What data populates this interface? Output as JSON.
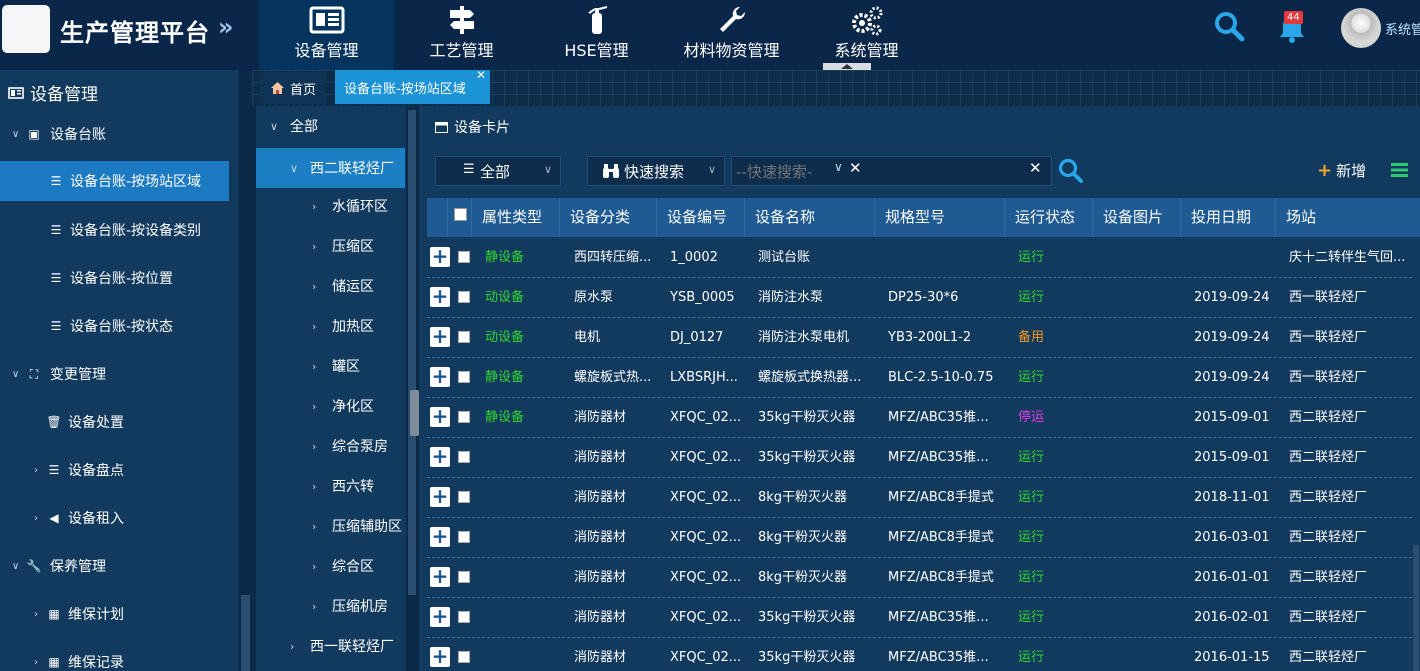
{
  "app": {
    "title": "生产管理平台",
    "collapse_glyph": "»"
  },
  "nav": [
    {
      "label": "设备管理",
      "icon": "equipment-card-icon"
    },
    {
      "label": "工艺管理",
      "icon": "signpost-icon"
    },
    {
      "label": "HSE管理",
      "icon": "fire-extinguisher-icon"
    },
    {
      "label": "材料物资管理",
      "icon": "wrench-icon"
    },
    {
      "label": "系统管理",
      "icon": "gears-icon"
    }
  ],
  "header_right": {
    "notification_count": "44",
    "user_name": "系统管理员"
  },
  "sidebar": {
    "title": "设备管理",
    "items": [
      {
        "label": "设备台账",
        "level": 1,
        "expanded": true
      },
      {
        "label": "设备台账-按场站区域",
        "level": 2,
        "active": true
      },
      {
        "label": "设备台账-按设备类别",
        "level": 2
      },
      {
        "label": "设备台账-按位置",
        "level": 2
      },
      {
        "label": "设备台账-按状态",
        "level": 2
      },
      {
        "label": "变更管理",
        "level": 1,
        "expanded": true
      },
      {
        "label": "设备处置",
        "level": 2
      },
      {
        "label": "设备盘点",
        "level": 2
      },
      {
        "label": "设备租入",
        "level": 2
      },
      {
        "label": "保养管理",
        "level": 1,
        "expanded": true
      },
      {
        "label": "维保计划",
        "level": 2
      },
      {
        "label": "维保记录",
        "level": 2
      }
    ]
  },
  "tabs": {
    "home": "首页",
    "active": "设备台账-按场站区域"
  },
  "tree": {
    "root": "全部",
    "selected": "西二联轻烃厂",
    "children": [
      "水循环区",
      "压缩区",
      "储运区",
      "加热区",
      "罐区",
      "净化区",
      "综合泵房",
      "西六转",
      "压缩辅助区",
      "综合区",
      "压缩机房"
    ],
    "sibling": "西一联轻烃厂"
  },
  "card": {
    "title": "设备卡片"
  },
  "toolbar": {
    "filter_value": "全部",
    "quick_search_label": "快速搜索",
    "search_placeholder": "--快速搜索-",
    "add_label": "新增"
  },
  "table": {
    "columns": [
      "属性类型",
      "设备分类",
      "设备编号",
      "设备名称",
      "规格型号",
      "运行状态",
      "设备图片",
      "投用日期",
      "场站"
    ],
    "rows": [
      {
        "type": "静设备",
        "category": "西四转压缩...",
        "code": "1_0002",
        "name": "测试台账",
        "spec": "",
        "status": "运行",
        "image": "",
        "date": "",
        "station": "庆十二转伴生气回..."
      },
      {
        "type": "动设备",
        "category": "原水泵",
        "code": "YSB_0005",
        "name": "消防注水泵",
        "spec": "DP25-30*6",
        "status": "运行",
        "image": "",
        "date": "2019-09-24",
        "station": "西一联轻烃厂"
      },
      {
        "type": "动设备",
        "category": "电机",
        "code": "DJ_0127",
        "name": "消防注水泵电机",
        "spec": "YB3-200L1-2",
        "status": "备用",
        "image": "",
        "date": "2019-09-24",
        "station": "西一联轻烃厂"
      },
      {
        "type": "静设备",
        "category": "螺旋板式热...",
        "code": "LXBSRJH...",
        "name": "螺旋板式换热器...",
        "spec": "BLC-2.5-10-0.75",
        "status": "运行",
        "image": "",
        "date": "2019-09-24",
        "station": "西一联轻烃厂"
      },
      {
        "type": "静设备",
        "category": "消防器材",
        "code": "XFQC_02...",
        "name": "35kg干粉灭火器",
        "spec": "MFZ/ABC35推...",
        "status": "停运",
        "image": "",
        "date": "2015-09-01",
        "station": "西二联轻烃厂"
      },
      {
        "type": "",
        "category": "消防器材",
        "code": "XFQC_02...",
        "name": "35kg干粉灭火器",
        "spec": "MFZ/ABC35推...",
        "status": "运行",
        "image": "",
        "date": "2015-09-01",
        "station": "西二联轻烃厂"
      },
      {
        "type": "",
        "category": "消防器材",
        "code": "XFQC_02...",
        "name": "8kg干粉灭火器",
        "spec": "MFZ/ABC8手提式",
        "status": "运行",
        "image": "",
        "date": "2018-11-01",
        "station": "西二联轻烃厂"
      },
      {
        "type": "",
        "category": "消防器材",
        "code": "XFQC_02...",
        "name": "8kg干粉灭火器",
        "spec": "MFZ/ABC8手提式",
        "status": "运行",
        "image": "",
        "date": "2016-03-01",
        "station": "西二联轻烃厂"
      },
      {
        "type": "",
        "category": "消防器材",
        "code": "XFQC_02...",
        "name": "8kg干粉灭火器",
        "spec": "MFZ/ABC8手提式",
        "status": "运行",
        "image": "",
        "date": "2016-01-01",
        "station": "西二联轻烃厂"
      },
      {
        "type": "",
        "category": "消防器材",
        "code": "XFQC_02...",
        "name": "35kg干粉灭火器",
        "spec": "MFZ/ABC35推...",
        "status": "运行",
        "image": "",
        "date": "2016-02-01",
        "station": "西二联轻烃厂"
      },
      {
        "type": "",
        "category": "消防器材",
        "code": "XFQC_02...",
        "name": "35kg干粉灭火器",
        "spec": "MFZ/ABC35推...",
        "status": "运行",
        "image": "",
        "date": "2016-01-15",
        "station": "西二联轻烃厂"
      }
    ]
  },
  "colors": {
    "running": "#2fd62f",
    "standby": "#f39b22",
    "stopped": "#e23be3",
    "accent": "#1c93d6",
    "header": "#1f5a92"
  }
}
